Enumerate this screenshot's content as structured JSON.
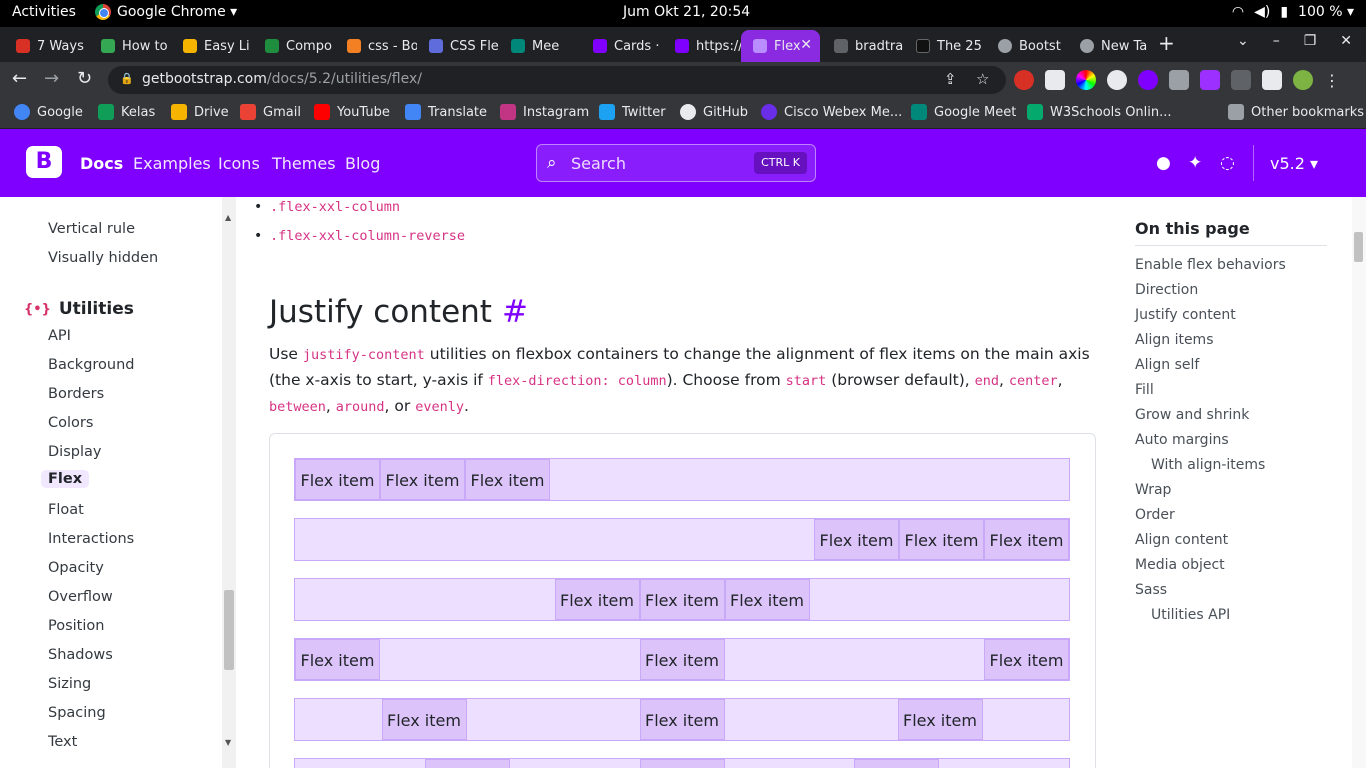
{
  "system": {
    "activities": "Activities",
    "app_name": "Google Chrome ▾",
    "clock": "Jum Okt 21, 20:54",
    "battery": "100 % ▾"
  },
  "tabs": [
    {
      "label": "7 Ways",
      "color": "#d93025"
    },
    {
      "label": "How to",
      "color": "#34a853"
    },
    {
      "label": "Easy Li",
      "color": "#f4b400"
    },
    {
      "label": "Compo",
      "color": "#1e8e3e"
    },
    {
      "label": "css - Bo",
      "color": "#f48024"
    },
    {
      "label": "CSS Fle",
      "color": "#5f6cdb"
    },
    {
      "label": "Mee",
      "color": "#00897b"
    },
    {
      "label": "Cards ·",
      "color": "#7f00ff"
    },
    {
      "label": "https://",
      "color": "#7f00ff"
    },
    {
      "label": "Flex",
      "color": "#7f00ff"
    },
    {
      "label": "bradtra",
      "color": "#5f6368"
    },
    {
      "label": "The 25",
      "color": "#111111"
    },
    {
      "label": "Bootst",
      "color": "#9aa0a6"
    },
    {
      "label": "New Ta",
      "color": "#9aa0a6"
    }
  ],
  "address": {
    "host": "getbootstrap.com",
    "path": "/docs/5.2/utilities/flex/"
  },
  "bookmarks": [
    {
      "label": "Google",
      "color": "#4285f4"
    },
    {
      "label": "Kelas",
      "color": "#0f9d58"
    },
    {
      "label": "Drive",
      "color": "#f4b400"
    },
    {
      "label": "Gmail",
      "color": "#ea4335"
    },
    {
      "label": "YouTube",
      "color": "#ff0000"
    },
    {
      "label": "Translate",
      "color": "#4285f4"
    },
    {
      "label": "Instagram",
      "color": "#c13584"
    },
    {
      "label": "Twitter",
      "color": "#1da1f2"
    },
    {
      "label": "GitHub",
      "color": "#e8eaed"
    },
    {
      "label": "Cisco Webex Me...",
      "color": "#6a2ee8"
    },
    {
      "label": "Google Meet",
      "color": "#00897b"
    },
    {
      "label": "W3Schools Onlin...",
      "color": "#04aa6d"
    },
    {
      "label": "Other bookmarks",
      "color": "#9aa0a6"
    }
  ],
  "navbar": {
    "brand": "B",
    "links": [
      "Docs",
      "Examples",
      "Icons",
      "Themes",
      "Blog"
    ],
    "search_placeholder": "Search",
    "search_shortcut": "CTRL K",
    "version": "v5.2 ▾"
  },
  "sidebar": {
    "top_items": [
      "Vertical rule",
      "Visually hidden"
    ],
    "group_title": "Utilities",
    "group_icon": "{•}",
    "items": [
      "API",
      "Background",
      "Borders",
      "Colors",
      "Display",
      "Flex",
      "Float",
      "Interactions",
      "Opacity",
      "Overflow",
      "Position",
      "Shadows",
      "Sizing",
      "Spacing",
      "Text"
    ]
  },
  "content": {
    "bullets": [
      ".flex-xxl-column",
      ".flex-xxl-column-reverse"
    ],
    "heading": "Justify content",
    "anchor": "#",
    "para": {
      "t1": "Use ",
      "c1": "justify-content",
      "t2": " utilities on flexbox containers to change the alignment of flex items on the main axis (the x-axis to start, y-axis if ",
      "c2": "flex-direction: column",
      "t3": "). Choose from ",
      "c3": "start",
      "t4": " (browser default), ",
      "c4": "end",
      "t5": ", ",
      "c5": "center",
      "t6": ", ",
      "c6": "between",
      "t7": ", ",
      "c7": "around",
      "t8": ", or ",
      "c8": "evenly",
      "t9": "."
    },
    "flex_item_label": "Flex item"
  },
  "toc": {
    "title": "On this page",
    "links": [
      "Enable flex behaviors",
      "Direction",
      "Justify content",
      "Align items",
      "Align self",
      "Fill",
      "Grow and shrink",
      "Auto margins",
      "With align-items",
      "Wrap",
      "Order",
      "Align content",
      "Media object",
      "Sass",
      "Utilities API"
    ]
  }
}
